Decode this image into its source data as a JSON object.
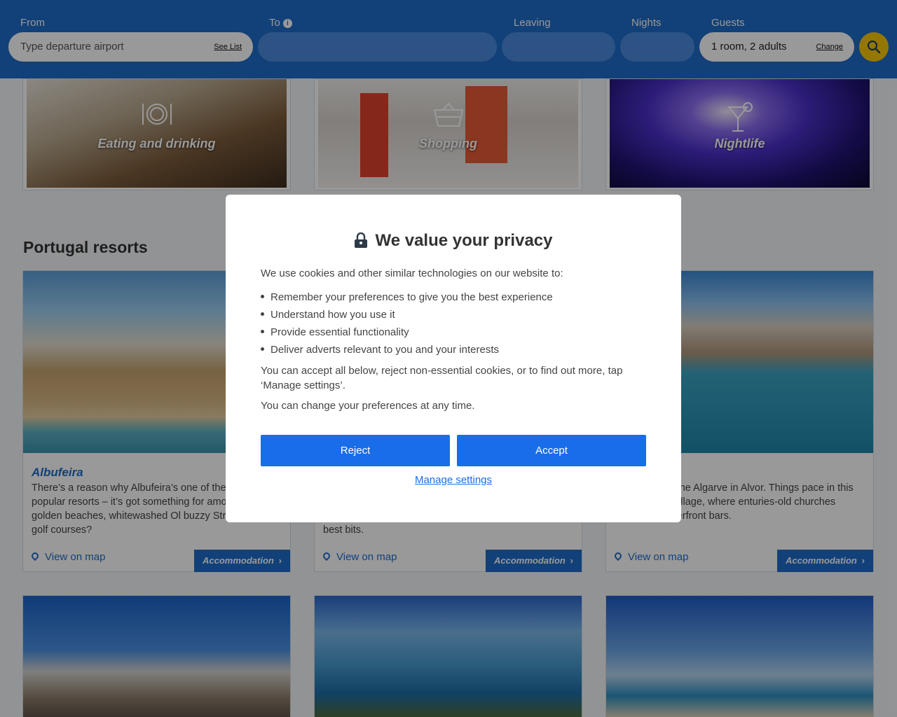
{
  "search": {
    "from_label": "From",
    "from_placeholder": "Type departure airport",
    "see_list": "See List",
    "to_label": "To",
    "leaving_label": "Leaving",
    "nights_label": "Nights",
    "guests_label": "Guests",
    "guests_value": "1 room, 2 adults",
    "change": "Change"
  },
  "activities": [
    {
      "label": "Eating and drinking",
      "icon": "dining-icon"
    },
    {
      "label": "Shopping",
      "icon": "basket-icon"
    },
    {
      "label": "Nightlife",
      "icon": "cocktail-icon"
    }
  ],
  "section_title": "Portugal resorts",
  "resorts": [
    {
      "title": "Albufeira",
      "description": "There’s a reason why Albufeira’s one of the most popular resorts – it’s got something for among its golden beaches, whitewashed Ol buzzy Strip. Great golf courses?",
      "map_label": "View on map",
      "accommodation_label": "Accommodation"
    },
    {
      "title": "",
      "description": "best bits.",
      "map_label": "View on map",
      "accommodation_label": "Accommodation"
    },
    {
      "title": "",
      "description": "itional side of the Algarve in Alvor. Things pace in this dinky fishing village, where enturies-old churches alongside waterfront bars.",
      "map_label": "View on map",
      "accommodation_label": "Accommodation"
    }
  ],
  "consent": {
    "title": "We value your privacy",
    "intro": "We use cookies and other similar technologies on our website to:",
    "items": [
      "Remember your preferences to give you the best experience",
      "Understand how you use it",
      "Provide essential functionality",
      "Deliver adverts relevant to you and your interests"
    ],
    "paragraph1": "You can accept all below, reject non-essential cookies, or to find out more, tap ‘Manage settings’.",
    "paragraph2": "You can change your preferences at any time.",
    "reject_label": "Reject",
    "accept_label": "Accept",
    "manage_label": "Manage settings"
  },
  "colors": {
    "header_blue": "#1f6cc8",
    "search_yellow": "#f7c600",
    "consent_button_blue": "#1a6de8"
  }
}
